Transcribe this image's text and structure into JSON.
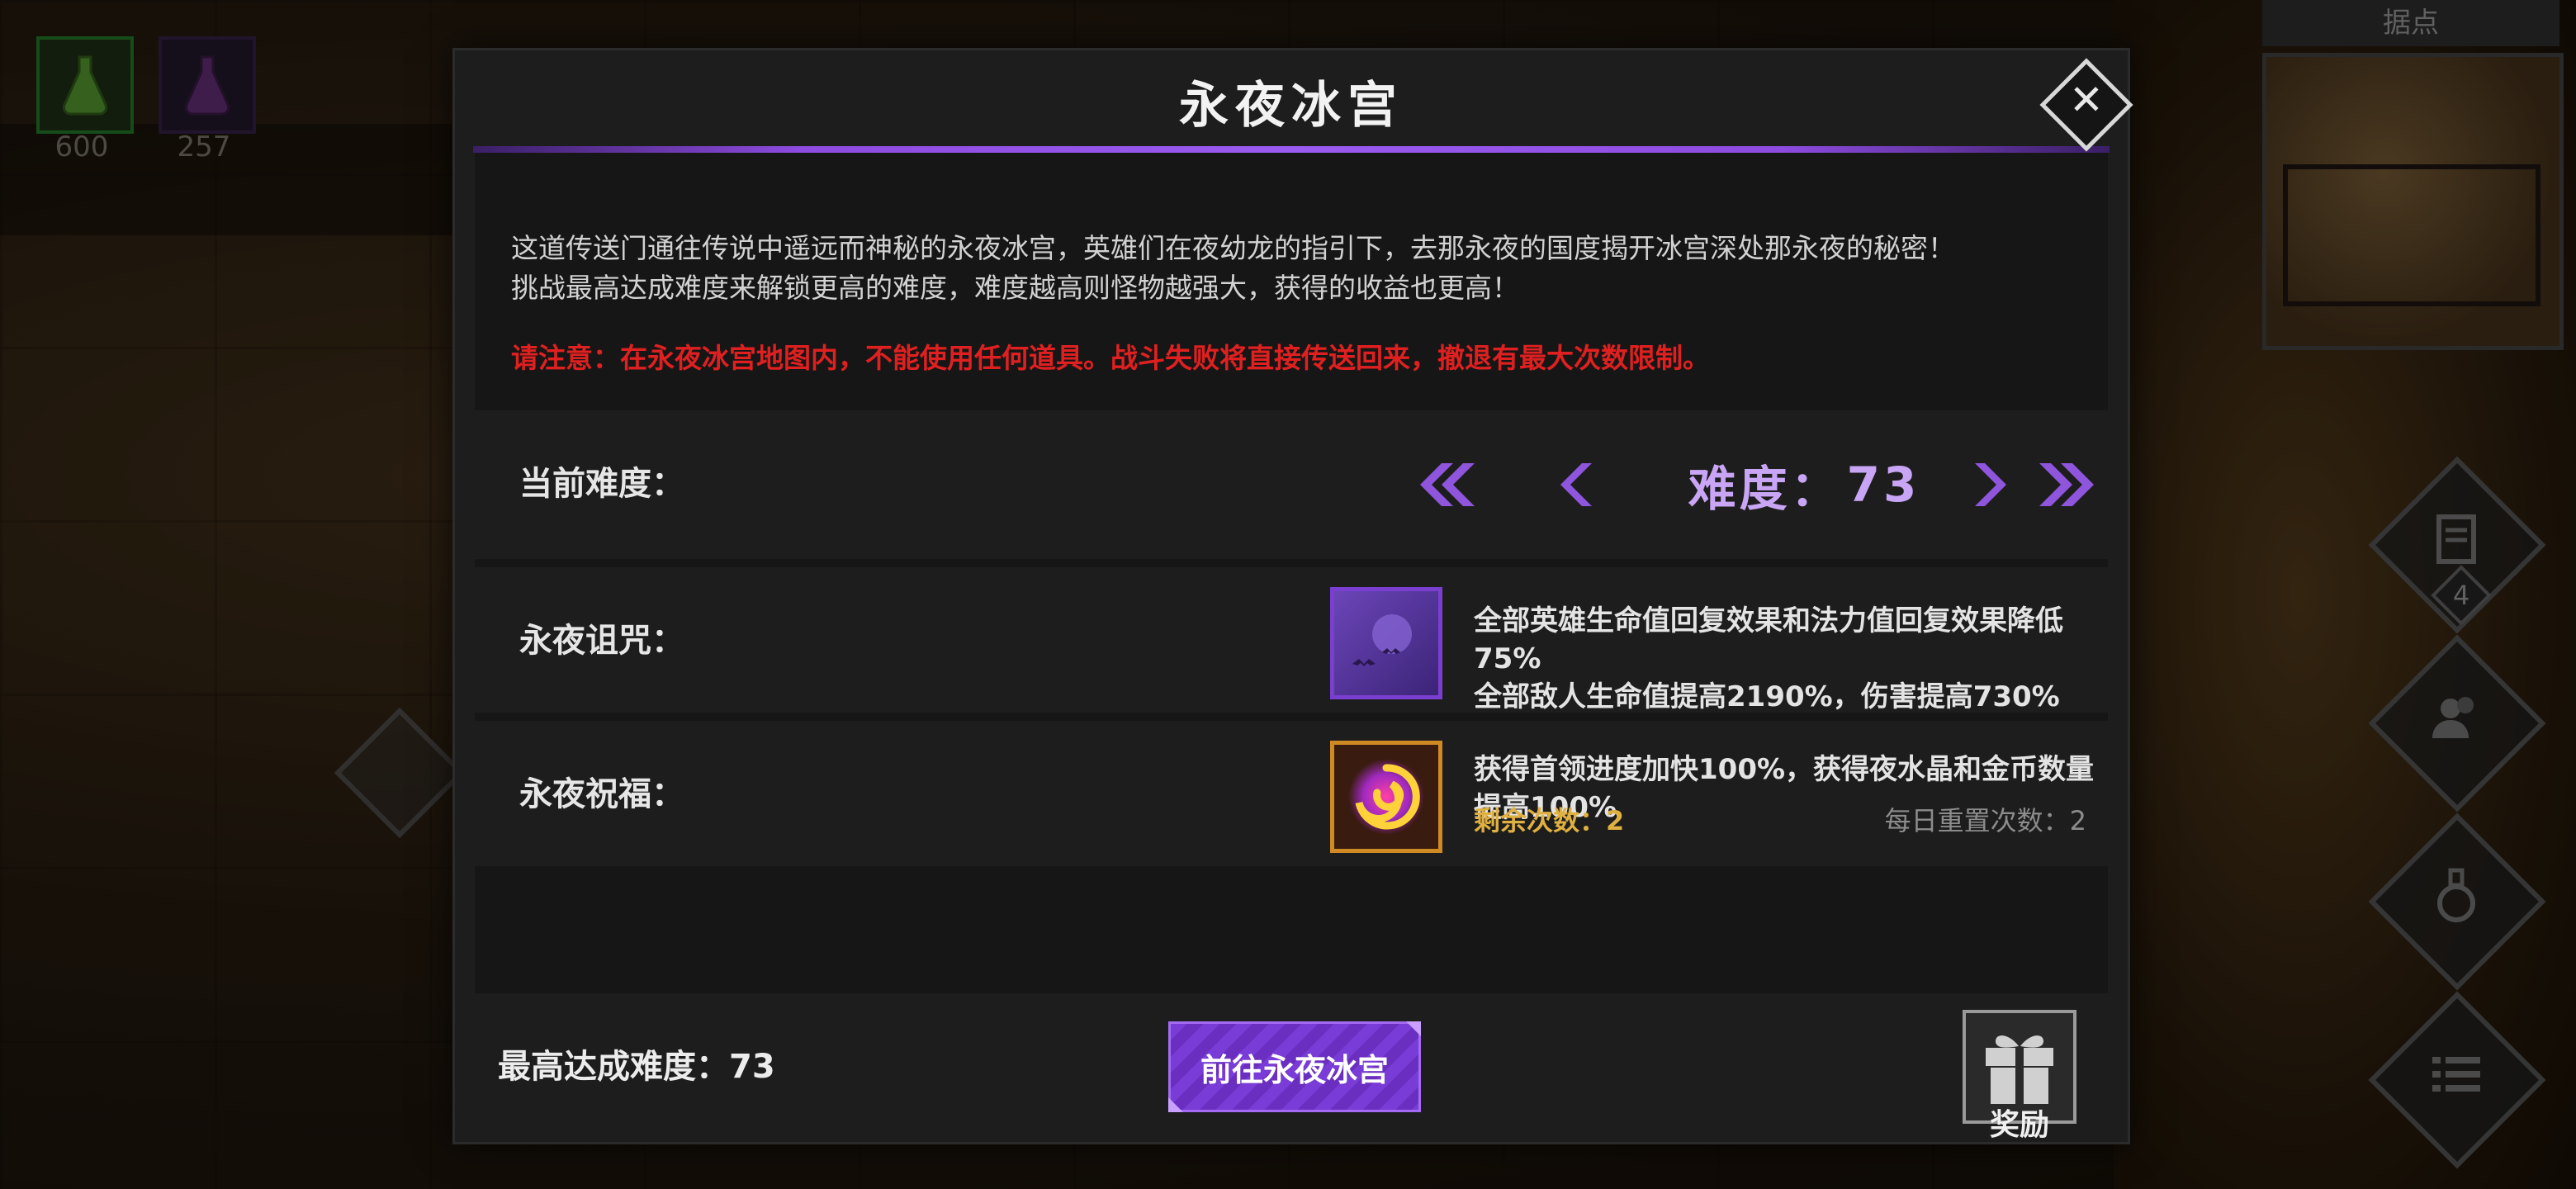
{
  "hud": {
    "resource_1": {
      "count": "600",
      "icon": "green-flask-icon"
    },
    "resource_2": {
      "count": "257",
      "icon": "purple-flask-icon"
    },
    "minimap_label": "据点",
    "quest_badge": "4"
  },
  "modal": {
    "title": "永夜冰宫",
    "description_lines": [
      "这道传送门通往传说中遥远而神秘的永夜冰宫，英雄们在夜幼龙的指引下，去那永夜的国度揭开冰宫深处那永夜的秘密！",
      "挑战最高达成难度来解锁更高的难度，难度越高则怪物越强大，获得的收益也更高！"
    ],
    "warning": "请注意：在永夜冰宫地图内，不能使用任何道具。战斗失败将直接传送回来，撤退有最大次数限制。",
    "difficulty": {
      "label": "当前难度：",
      "value_label": "难度：",
      "value": "73"
    },
    "curse": {
      "label": "永夜诅咒：",
      "line1": "全部英雄生命值回复效果和法力值回复效果降低75%",
      "line2": "全部敌人生命值提高2190%，伤害提高730%"
    },
    "blessing": {
      "label": "永夜祝福：",
      "line1": "获得首领进度加快100%，获得夜水晶和金币数量提高100%",
      "remaining": "剩余次数：2",
      "daily_reset": "每日重置次数：2"
    },
    "best_difficulty": "最高达成难度：73",
    "go_button": "前往永夜冰宫",
    "reward_label": "奖励"
  },
  "colors": {
    "accent_purple": "#8e4be0",
    "warning_red": "#e02020",
    "gold": "#e0b040"
  }
}
